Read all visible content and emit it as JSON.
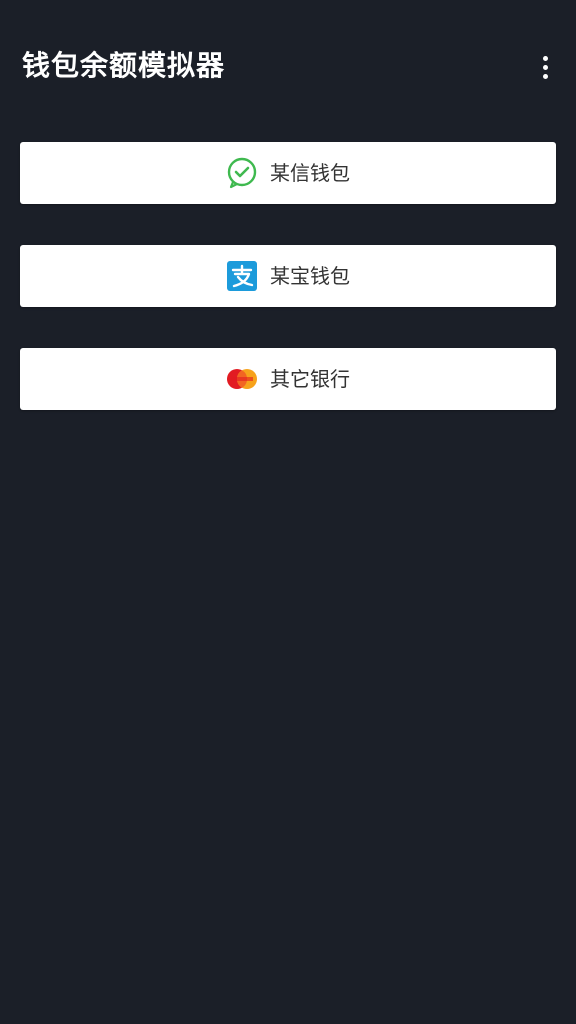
{
  "app_bar": {
    "title": "钱包余额模拟器",
    "menu_icon": "more-vert-icon"
  },
  "wallets": [
    {
      "label": "某信钱包",
      "icon": "wechat-icon",
      "icon_color": "#3fb94f"
    },
    {
      "label": "某宝钱包",
      "icon": "alipay-icon",
      "icon_color": "#1c9bdb"
    },
    {
      "label": "其它银行",
      "icon": "mastercard-icon",
      "icon_color": "#e21b22"
    }
  ],
  "colors": {
    "background": "#1b1f28",
    "button_bg": "#ffffff",
    "button_text": "#333333",
    "title_text": "#ffffff"
  }
}
